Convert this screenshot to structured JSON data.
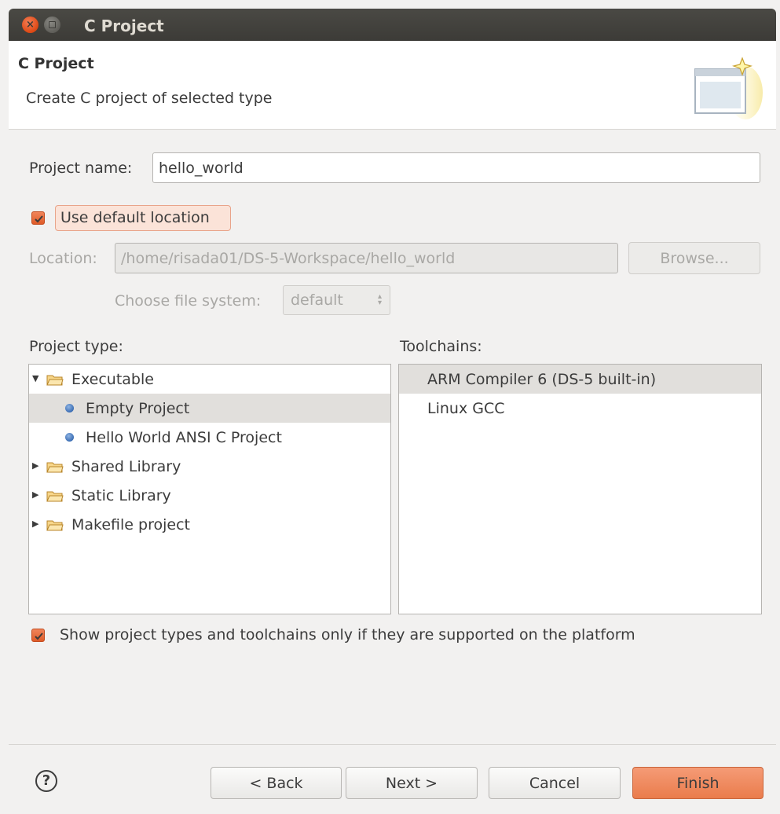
{
  "window": {
    "title": "C Project"
  },
  "header": {
    "title": "C Project",
    "description": "Create C project of selected type"
  },
  "project_name": {
    "label": "Project name:",
    "value": "hello_world"
  },
  "default_location": {
    "label": "Use default location",
    "checked": true
  },
  "location": {
    "label": "Location:",
    "value": "/home/risada01/DS-5-Workspace/hello_world",
    "browse_label": "Browse..."
  },
  "file_system": {
    "label": "Choose file system:",
    "value": "default"
  },
  "project_type": {
    "label": "Project type:",
    "items": [
      {
        "label": "Executable",
        "kind": "folder",
        "expanded": true,
        "level": 0
      },
      {
        "label": "Empty Project",
        "kind": "leaf",
        "selected": true,
        "level": 1
      },
      {
        "label": "Hello World ANSI C Project",
        "kind": "leaf",
        "selected": false,
        "level": 1
      },
      {
        "label": "Shared Library",
        "kind": "folder",
        "expanded": false,
        "level": 0
      },
      {
        "label": "Static Library",
        "kind": "folder",
        "expanded": false,
        "level": 0
      },
      {
        "label": "Makefile project",
        "kind": "folder",
        "expanded": false,
        "level": 0
      }
    ]
  },
  "toolchains": {
    "label": "Toolchains:",
    "items": [
      {
        "label": "ARM Compiler 6 (DS-5 built-in)",
        "selected": true
      },
      {
        "label": "Linux GCC",
        "selected": false
      }
    ]
  },
  "show_supported": {
    "label": "Show project types and toolchains only if they are supported on the platform",
    "checked": true
  },
  "buttons": {
    "help": "?",
    "back": "< Back",
    "next": "Next >",
    "cancel": "Cancel",
    "finish": "Finish"
  },
  "colors": {
    "accent": "#e9723f",
    "titlebar": "#3c3b37",
    "selection": "#e1dfdc"
  }
}
